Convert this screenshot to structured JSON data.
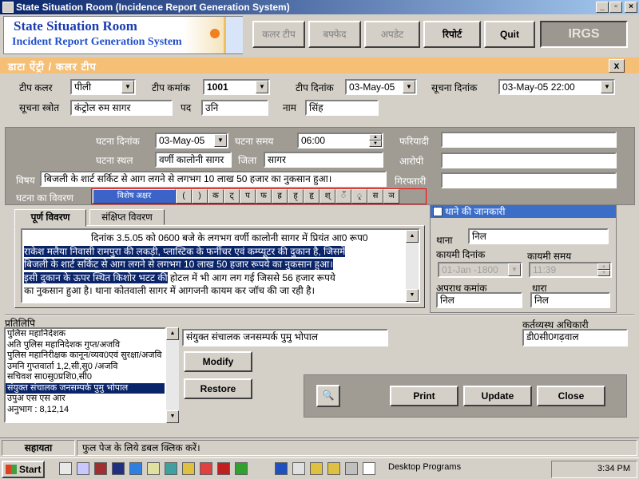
{
  "window": {
    "title": "State Situation Room (Incidence Report Generation System)",
    "min": "_",
    "restore": "▫",
    "close": "×"
  },
  "header": {
    "logo_line1": "State Situation Room",
    "logo_line2": "Incident Report Generation System",
    "buttons": [
      "कलर टीप",
      "बफ्फेद",
      "अपडेट",
      "रिपोर्ट",
      "Quit"
    ],
    "brand": "IRGS"
  },
  "section": {
    "title": "डाटा ऐंट्री / कलर टीप",
    "close": "x"
  },
  "form": {
    "tip_color_label": "टीप कलर",
    "tip_color_value": "पीली",
    "tip_number_label": "टीप कमांक",
    "tip_number_value": "1001",
    "tip_date_label": "टीप दिनांक",
    "tip_date_value": "03-May-05",
    "info_date_label": "सूचना दिनांक",
    "info_date_value": "03-May-05 22:00",
    "info_source_label": "सूचना स्त्रोत",
    "info_source_value": "कंट्रोल रुम सागर",
    "post_label": "पद",
    "post_value": "उनि",
    "name_label": "नाम",
    "name_value": "सिंह"
  },
  "incident": {
    "date_label": "घटना दिनांक",
    "date_value": "03-May-05",
    "time_label": "घटना समय",
    "time_value": "06:00",
    "place_label": "घटना स्थल",
    "place_value": "वर्णी कालोनी सागर",
    "district_label": "जिला",
    "district_value": "सागर",
    "complainant_label": "फरियादी",
    "complainant_value": "",
    "accused_label": "आरोपी",
    "accused_value": "",
    "arrest_label": "गिरफ्तारी",
    "arrest_value": "",
    "subject_label": "विषय",
    "subject_value": "बिजली के शार्ट सर्किट से आग लगने से लगभग 10 लाख 50 हजार का नुकसान हुआ।",
    "details_label": "घटना का विवरण",
    "keys": [
      "विशेष अक्षर",
      "(",
      ")",
      "क",
      "ट्",
      "प",
      "फ",
      "ह्र",
      "ह्",
      "हृ",
      "श्",
      "ॅ",
      "ृ",
      "स",
      "ञ"
    ]
  },
  "tabs": [
    "पूर्ण विवरण",
    "संक्षिप्त विवरण"
  ],
  "details_text": {
    "line1": "दिनांक 3.5.05 को 0600 बजे के लगभग वर्णी कालोनी सागर में प्रियंत आ0 रूप0",
    "line2a": "राकेश मलैया निवासी रामपुरा की लकड़ी, प्लास्टिक के फर्नीचर एवं कम्प्यूटर की दुकान है, जिसमें",
    "line3": "बिजली के शार्ट सर्किट से आग लगने से लगभग 10 लाख 50 हजार रूपये का नुकसान हुआ।",
    "line4a": "इसी दुकान के ऊपर स्थित किशोर भटट की",
    "line4b": " होटल में भी आग लग गई जिससे 56 हजार रूपये",
    "line5": "का नुकसान हुआ है। थाना कोतवाली सागर में आगजनी कायम कर जॉच की जा रही है।"
  },
  "police": {
    "header": "थाने की जानकारी",
    "station_label": "थाना",
    "station_value": "निल",
    "reg_date_label": "कायमी दिनांक",
    "reg_date_value": "01-Jan -1800",
    "reg_time_label": "कायमी समय",
    "reg_time_value": "11:39",
    "crime_no_label": "अपराध कमांक",
    "crime_no_value": "निल",
    "section_label": "धारा",
    "section_value": "निल"
  },
  "copy": {
    "label": "प्रतिलिपि",
    "items": [
      "पुलिस महानिदेशक",
      "अति पुलिस महानिदेशक गुप्त/अजवि",
      "पुलिस महानिरीक्षक कानून/व्यव0एवं सुरक्षा/अजवि",
      "उमनि गुप्तवार्ता 1,2,सी,सु0 /अजवि",
      "सचिवश सा0सु0प्रशि0,सी0",
      "संयुक्त संचालक जनसम्पर्क पुमु भोपाल",
      "उपुअ एस एस आर",
      "अनुभाग : 8,12,14"
    ],
    "selected_index": 5,
    "edit_value": "संयुक्त संचालक जनसम्पर्क पुमु भोपाल",
    "modify": "Modify",
    "restore": "Restore"
  },
  "officer": {
    "label": "कर्तव्यस्थ अधिकारी",
    "value": "डी0सी0गढ़वाल"
  },
  "actions": {
    "print": "Print",
    "update": "Update",
    "close": "Close"
  },
  "status": {
    "help": "सहायता",
    "message": "फुल पेज के लिये डबल क्लिक करें।"
  },
  "taskbar": {
    "start": "Start",
    "desktop_programs": "Desktop Programs",
    "clock": "3:34 PM"
  }
}
